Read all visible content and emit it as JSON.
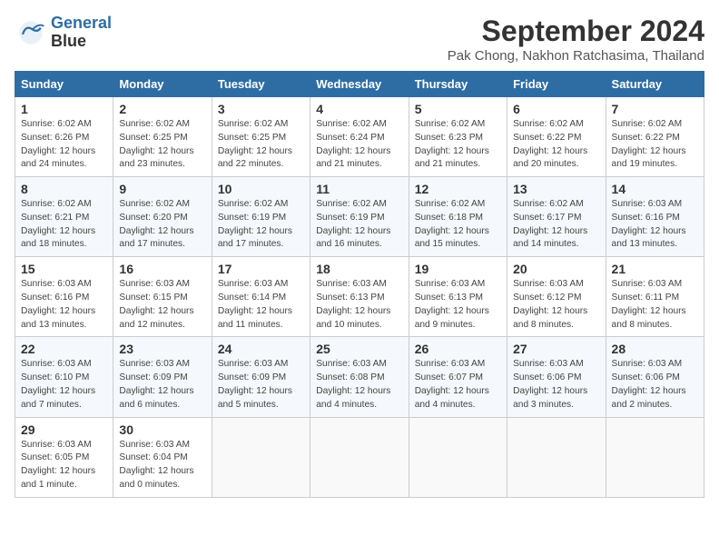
{
  "header": {
    "logo_line1": "General",
    "logo_line2": "Blue",
    "month": "September 2024",
    "location": "Pak Chong, Nakhon Ratchasima, Thailand"
  },
  "weekdays": [
    "Sunday",
    "Monday",
    "Tuesday",
    "Wednesday",
    "Thursday",
    "Friday",
    "Saturday"
  ],
  "weeks": [
    [
      {
        "day": "1",
        "info": "Sunrise: 6:02 AM\nSunset: 6:26 PM\nDaylight: 12 hours\nand 24 minutes."
      },
      {
        "day": "2",
        "info": "Sunrise: 6:02 AM\nSunset: 6:25 PM\nDaylight: 12 hours\nand 23 minutes."
      },
      {
        "day": "3",
        "info": "Sunrise: 6:02 AM\nSunset: 6:25 PM\nDaylight: 12 hours\nand 22 minutes."
      },
      {
        "day": "4",
        "info": "Sunrise: 6:02 AM\nSunset: 6:24 PM\nDaylight: 12 hours\nand 21 minutes."
      },
      {
        "day": "5",
        "info": "Sunrise: 6:02 AM\nSunset: 6:23 PM\nDaylight: 12 hours\nand 21 minutes."
      },
      {
        "day": "6",
        "info": "Sunrise: 6:02 AM\nSunset: 6:22 PM\nDaylight: 12 hours\nand 20 minutes."
      },
      {
        "day": "7",
        "info": "Sunrise: 6:02 AM\nSunset: 6:22 PM\nDaylight: 12 hours\nand 19 minutes."
      }
    ],
    [
      {
        "day": "8",
        "info": "Sunrise: 6:02 AM\nSunset: 6:21 PM\nDaylight: 12 hours\nand 18 minutes."
      },
      {
        "day": "9",
        "info": "Sunrise: 6:02 AM\nSunset: 6:20 PM\nDaylight: 12 hours\nand 17 minutes."
      },
      {
        "day": "10",
        "info": "Sunrise: 6:02 AM\nSunset: 6:19 PM\nDaylight: 12 hours\nand 17 minutes."
      },
      {
        "day": "11",
        "info": "Sunrise: 6:02 AM\nSunset: 6:19 PM\nDaylight: 12 hours\nand 16 minutes."
      },
      {
        "day": "12",
        "info": "Sunrise: 6:02 AM\nSunset: 6:18 PM\nDaylight: 12 hours\nand 15 minutes."
      },
      {
        "day": "13",
        "info": "Sunrise: 6:02 AM\nSunset: 6:17 PM\nDaylight: 12 hours\nand 14 minutes."
      },
      {
        "day": "14",
        "info": "Sunrise: 6:03 AM\nSunset: 6:16 PM\nDaylight: 12 hours\nand 13 minutes."
      }
    ],
    [
      {
        "day": "15",
        "info": "Sunrise: 6:03 AM\nSunset: 6:16 PM\nDaylight: 12 hours\nand 13 minutes."
      },
      {
        "day": "16",
        "info": "Sunrise: 6:03 AM\nSunset: 6:15 PM\nDaylight: 12 hours\nand 12 minutes."
      },
      {
        "day": "17",
        "info": "Sunrise: 6:03 AM\nSunset: 6:14 PM\nDaylight: 12 hours\nand 11 minutes."
      },
      {
        "day": "18",
        "info": "Sunrise: 6:03 AM\nSunset: 6:13 PM\nDaylight: 12 hours\nand 10 minutes."
      },
      {
        "day": "19",
        "info": "Sunrise: 6:03 AM\nSunset: 6:13 PM\nDaylight: 12 hours\nand 9 minutes."
      },
      {
        "day": "20",
        "info": "Sunrise: 6:03 AM\nSunset: 6:12 PM\nDaylight: 12 hours\nand 8 minutes."
      },
      {
        "day": "21",
        "info": "Sunrise: 6:03 AM\nSunset: 6:11 PM\nDaylight: 12 hours\nand 8 minutes."
      }
    ],
    [
      {
        "day": "22",
        "info": "Sunrise: 6:03 AM\nSunset: 6:10 PM\nDaylight: 12 hours\nand 7 minutes."
      },
      {
        "day": "23",
        "info": "Sunrise: 6:03 AM\nSunset: 6:09 PM\nDaylight: 12 hours\nand 6 minutes."
      },
      {
        "day": "24",
        "info": "Sunrise: 6:03 AM\nSunset: 6:09 PM\nDaylight: 12 hours\nand 5 minutes."
      },
      {
        "day": "25",
        "info": "Sunrise: 6:03 AM\nSunset: 6:08 PM\nDaylight: 12 hours\nand 4 minutes."
      },
      {
        "day": "26",
        "info": "Sunrise: 6:03 AM\nSunset: 6:07 PM\nDaylight: 12 hours\nand 4 minutes."
      },
      {
        "day": "27",
        "info": "Sunrise: 6:03 AM\nSunset: 6:06 PM\nDaylight: 12 hours\nand 3 minutes."
      },
      {
        "day": "28",
        "info": "Sunrise: 6:03 AM\nSunset: 6:06 PM\nDaylight: 12 hours\nand 2 minutes."
      }
    ],
    [
      {
        "day": "29",
        "info": "Sunrise: 6:03 AM\nSunset: 6:05 PM\nDaylight: 12 hours\nand 1 minute."
      },
      {
        "day": "30",
        "info": "Sunrise: 6:03 AM\nSunset: 6:04 PM\nDaylight: 12 hours\nand 0 minutes."
      },
      null,
      null,
      null,
      null,
      null
    ]
  ]
}
